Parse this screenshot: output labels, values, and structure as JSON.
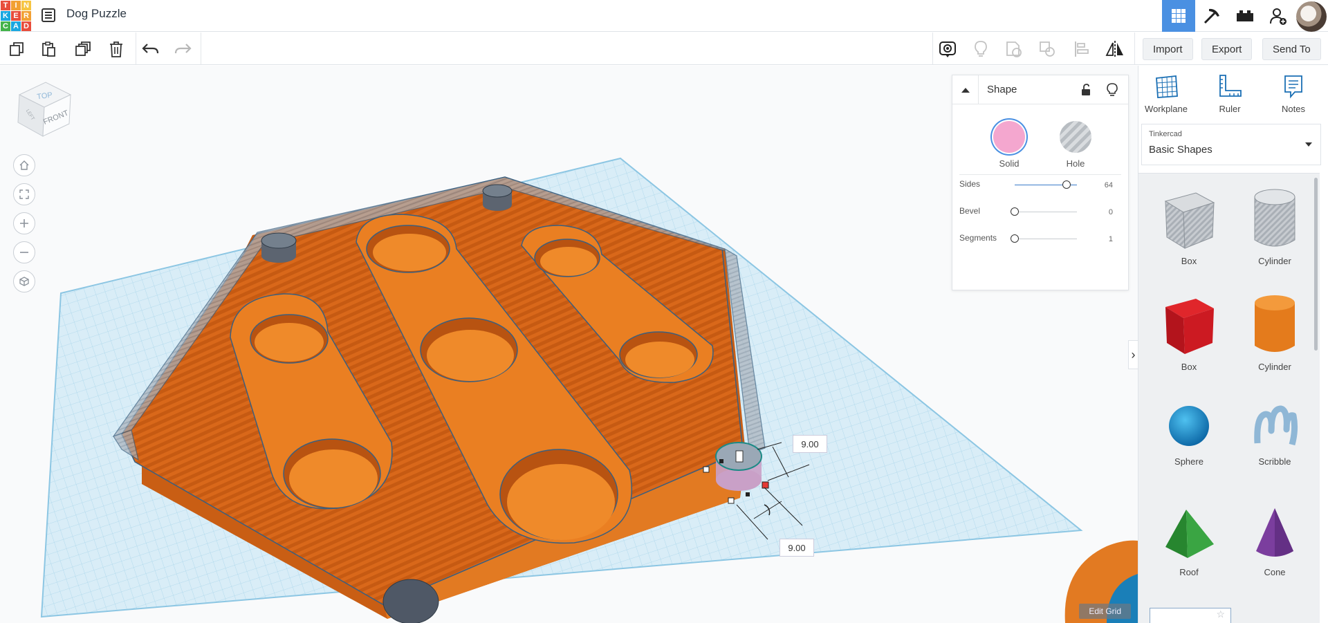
{
  "app": {
    "logo_letters": [
      "T",
      "I",
      "N",
      "K",
      "E",
      "R",
      "C",
      "A",
      "D"
    ],
    "logo_colors": [
      "#e84e3c",
      "#f2a033",
      "#f6c542",
      "#1aa7e0",
      "#e84e3c",
      "#f2a033",
      "#43b34a",
      "#1aa7e0",
      "#e84e3c"
    ],
    "document_title": "Dog Puzzle",
    "accent_color": "#4a90e2"
  },
  "header": {
    "view_buttons": [
      {
        "icon": "grid-view-icon",
        "active": true
      },
      {
        "icon": "pickaxe-icon",
        "active": false
      },
      {
        "icon": "bricks-icon",
        "active": false
      },
      {
        "icon": "add-user-icon",
        "active": false
      },
      {
        "icon": "avatar-icon",
        "active": false
      }
    ]
  },
  "toolbar": {
    "left_tools": [
      "copy-icon",
      "paste-icon",
      "duplicate-icon",
      "delete-icon",
      "undo-icon",
      "redo-icon"
    ],
    "right_tools": [
      "note-view-icon",
      "lightbulb-icon",
      "group-icon",
      "ungroup-icon",
      "align-icon",
      "mirror-icon"
    ],
    "import_label": "Import",
    "export_label": "Export",
    "send_to_label": "Send To"
  },
  "viewcube": {
    "top_label": "TOP",
    "front_label": "FRONT",
    "left_label": "LEFT"
  },
  "viewport": {
    "dimension_width": "9.00",
    "dimension_depth": "9.00",
    "edit_grid_label": "Edit Grid",
    "nav_buttons": [
      "home-icon",
      "fit-view-icon",
      "zoom-in-icon",
      "zoom-out-icon",
      "perspective-icon"
    ]
  },
  "inspector": {
    "title": "Shape",
    "solid_label": "Solid",
    "hole_label": "Hole",
    "solid_color": "#f4a7cf",
    "properties": [
      {
        "label": "Sides",
        "value": "64",
        "level": 0.83
      },
      {
        "label": "Bevel",
        "value": "0",
        "level": 0
      },
      {
        "label": "Segments",
        "value": "1",
        "level": 0
      }
    ]
  },
  "right_panel": {
    "tools": [
      {
        "label": "Workplane",
        "icon": "workplane-icon"
      },
      {
        "label": "Ruler",
        "icon": "ruler-icon"
      },
      {
        "label": "Notes",
        "icon": "notes-icon"
      }
    ],
    "library_owner": "Tinkercad",
    "library_name": "Basic Shapes",
    "shapes": [
      {
        "label": "Box",
        "icon": "box-hole-icon"
      },
      {
        "label": "Cylinder",
        "icon": "cylinder-hole-icon"
      },
      {
        "label": "Box",
        "icon": "box-icon"
      },
      {
        "label": "Cylinder",
        "icon": "cylinder-icon"
      },
      {
        "label": "Sphere",
        "icon": "sphere-icon"
      },
      {
        "label": "Scribble",
        "icon": "scribble-icon"
      },
      {
        "label": "Roof",
        "icon": "roof-icon"
      },
      {
        "label": "Cone",
        "icon": "cone-icon"
      }
    ]
  }
}
